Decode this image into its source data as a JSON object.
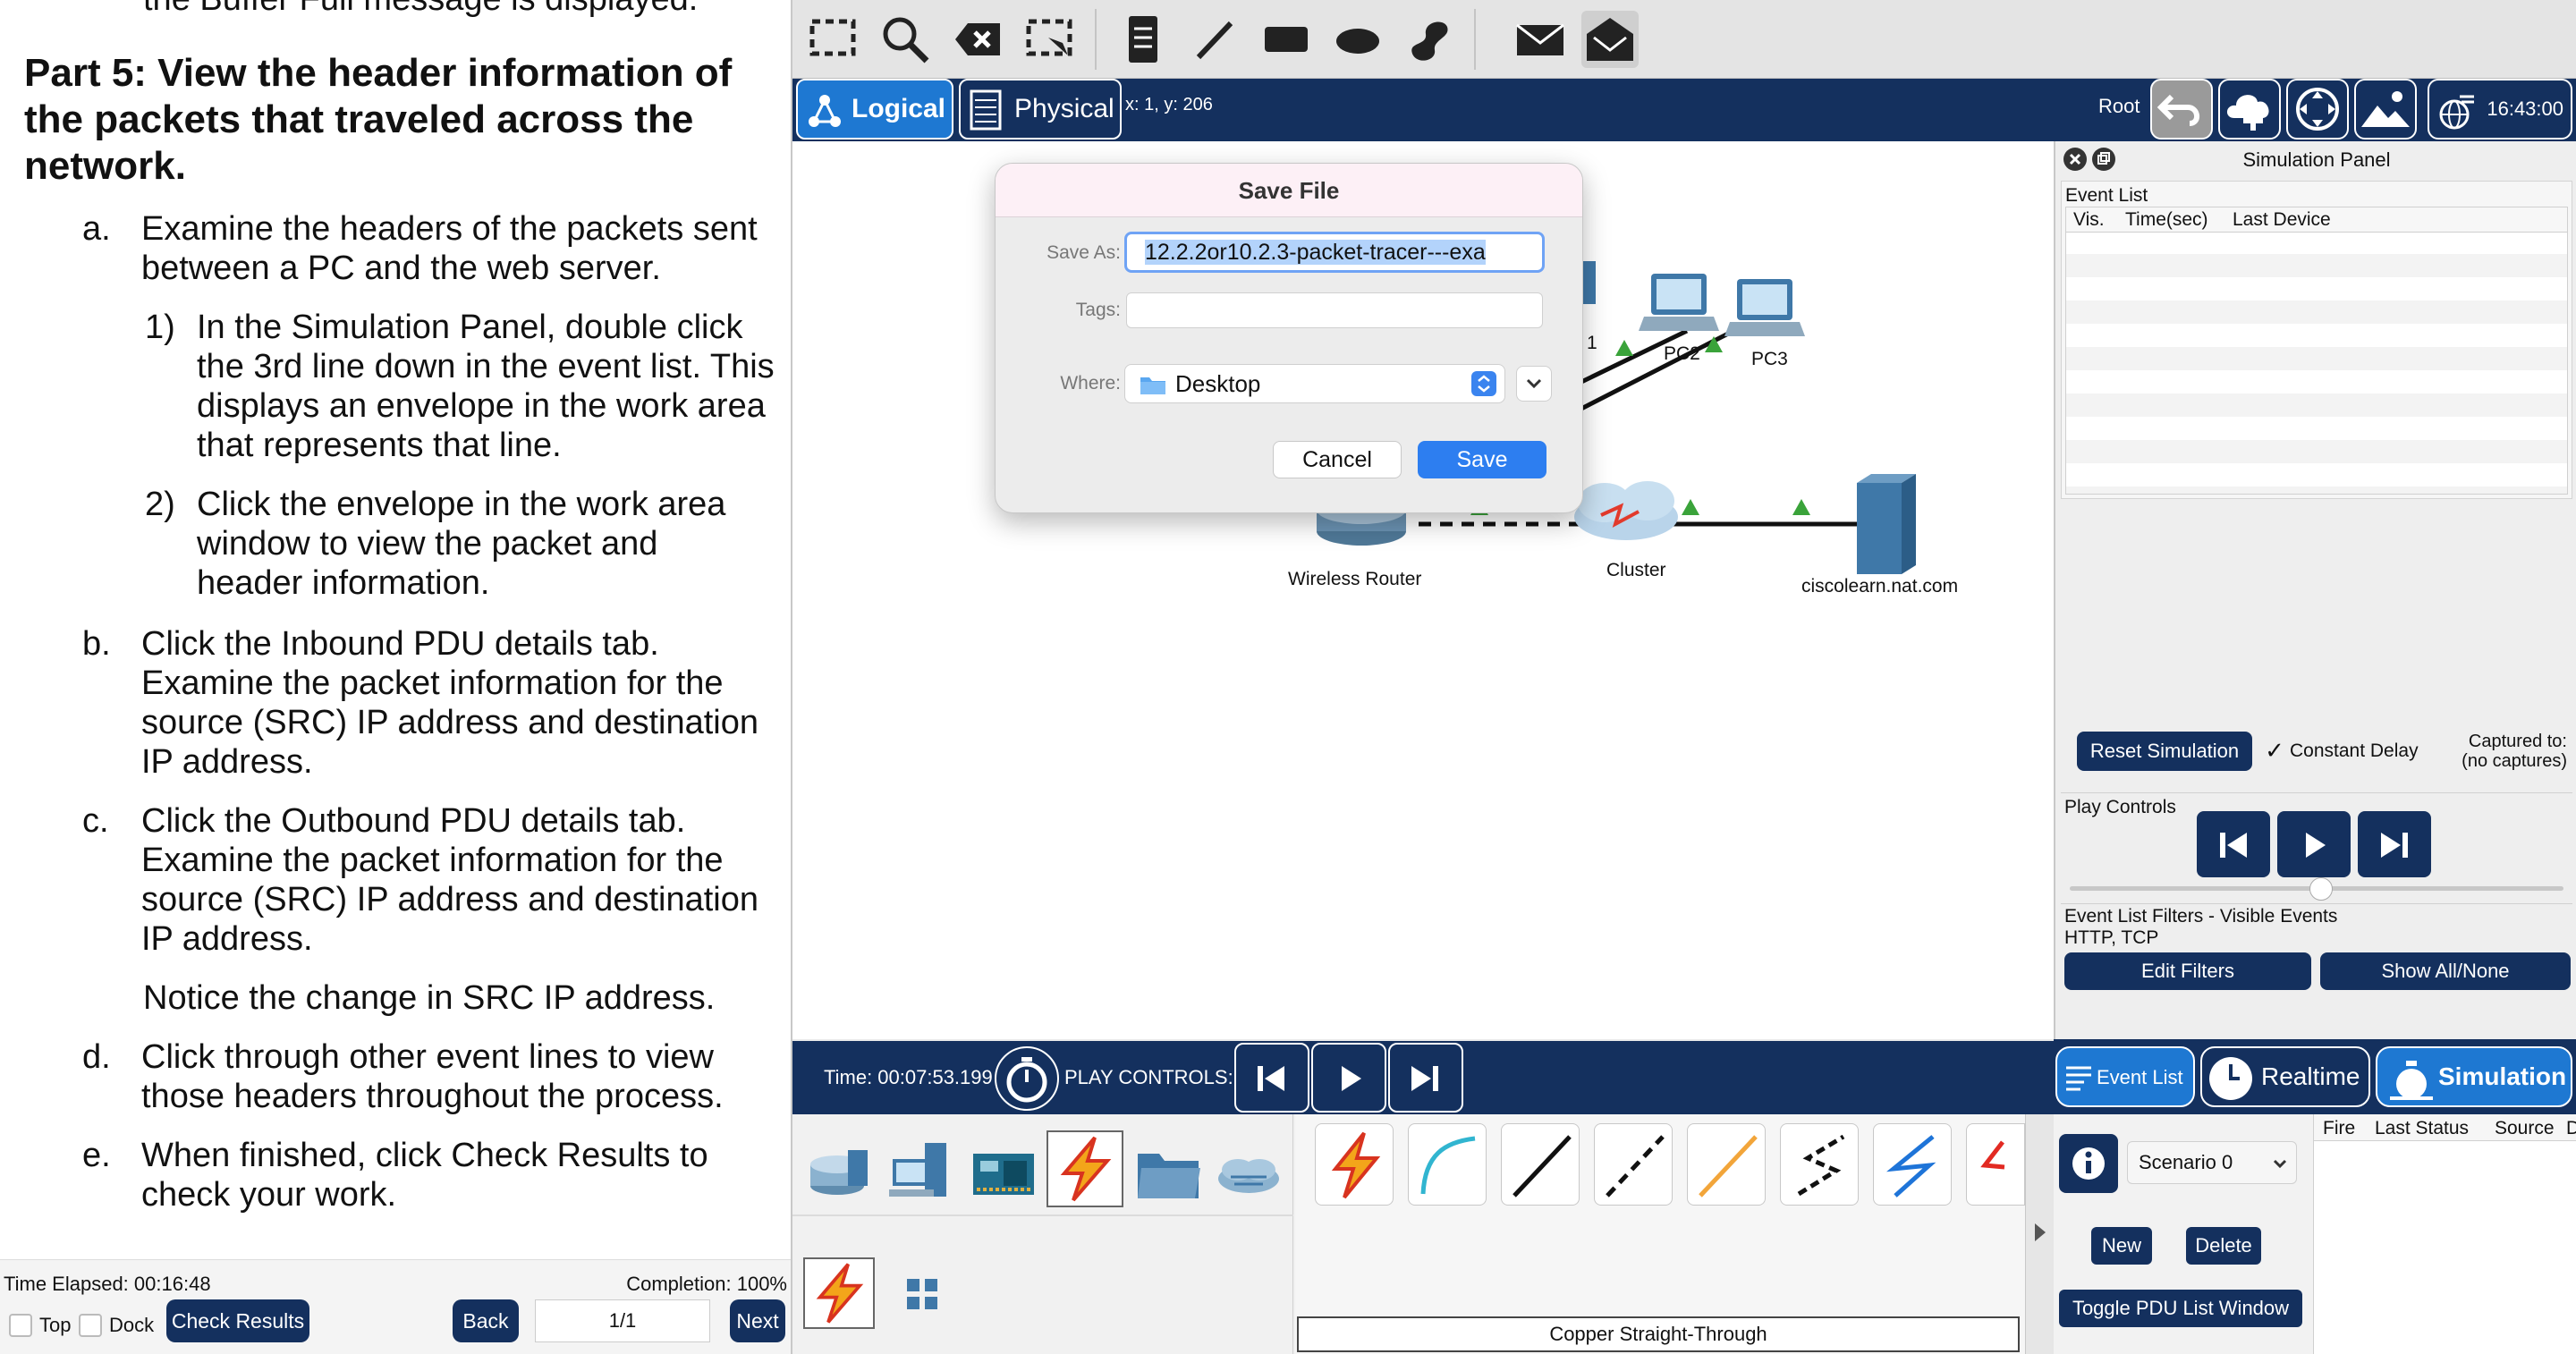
{
  "instructions": {
    "prev_line": "the Buffer Full message is displayed.",
    "part_title": "Part 5: View the header information of the packets that traveled across the network.",
    "a_label": "a.",
    "a_text": "Examine the headers of the packets sent between a PC and the web server.",
    "a1_label": "1)",
    "a1_text": "In the Simulation Panel, double click the 3rd line down in the event list. This displays an envelope in the work area that represents that line.",
    "a2_label": "2)",
    "a2_text": "Click the envelope in the work area window to view the packet and header information.",
    "b_label": "b.",
    "b_text": "Click the Inbound PDU details tab. Examine the packet information for the source (SRC) IP address and destination IP address.",
    "c_label": "c.",
    "c_text": "Click the Outbound PDU details tab. Examine the packet information for the source (SRC) IP address and destination IP address.",
    "c_note": "Notice the change in SRC IP address.",
    "d_label": "d.",
    "d_text": "Click through other event lines to view those headers throughout the process.",
    "e_label": "e.",
    "e_text": "When finished, click Check Results to check your work."
  },
  "left_status": {
    "time_elapsed": "Time Elapsed: 00:16:48",
    "completion": "Completion: 100%",
    "top_label": "Top",
    "dock_label": "Dock",
    "check_results": "Check Results",
    "back": "Back",
    "page": "1/1",
    "next": "Next"
  },
  "mode_bar": {
    "logical": "Logical",
    "physical": "Physical",
    "coords": "x: 1, y: 206",
    "root": "Root",
    "clock": "16:43:00"
  },
  "topology": {
    "pc1_partial": "1",
    "pc2": "PC2",
    "pc3": "PC3",
    "wireless_router": "Wireless Router",
    "cluster": "Cluster",
    "server": "ciscolearn.nat.com"
  },
  "save_dialog": {
    "title": "Save File",
    "save_as_label": "Save As:",
    "save_as_value": "12.2.2or10.2.3-packet-tracer---exa",
    "tags_label": "Tags:",
    "where_label": "Where:",
    "where_value": "Desktop",
    "cancel": "Cancel",
    "save": "Save"
  },
  "sim_panel": {
    "title": "Simulation Panel",
    "event_list": "Event List",
    "col_vis": "Vis.",
    "col_time": "Time(sec)",
    "col_last": "Last Device",
    "reset": "Reset Simulation",
    "constant_delay": "Constant Delay",
    "captured_1": "Captured to:",
    "captured_2": "(no captures)",
    "play_controls": "Play Controls",
    "filters_title": "Event List Filters - Visible Events",
    "filters_value": "HTTP, TCP",
    "edit_filters": "Edit Filters",
    "show_all": "Show All/None"
  },
  "time_bar": {
    "time": "Time: 00:07:53.199",
    "play_controls": "PLAY CONTROLS:"
  },
  "bottom_modes": {
    "event_list": "Event List",
    "realtime": "Realtime",
    "simulation": "Simulation"
  },
  "device_area": {
    "cable_label": "Copper Straight-Through"
  },
  "scenario": {
    "name": "Scenario 0",
    "new": "New",
    "delete": "Delete",
    "toggle": "Toggle PDU List Window",
    "col_fire": "Fire",
    "col_status": "Last Status",
    "col_source": "Source",
    "col_d": "D"
  },
  "colors": {
    "navy": "#14305e",
    "accent_blue": "#2d7ef0",
    "sim_blue": "#1e78d2",
    "link_green": "#3aa33a"
  }
}
